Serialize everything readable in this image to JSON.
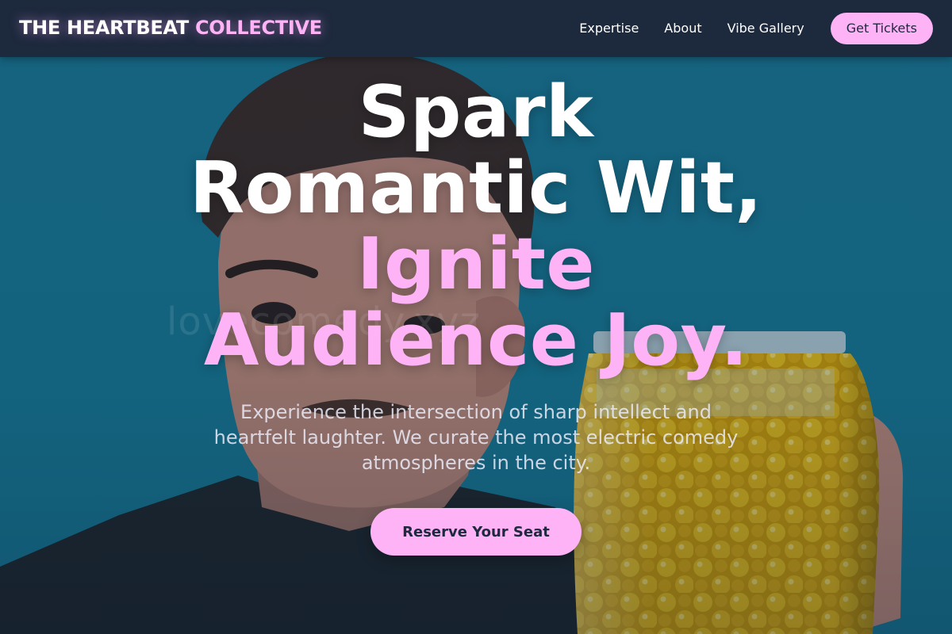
{
  "navbar": {
    "brand": {
      "primary": "THE HEARTBEAT",
      "accent": "COLLECTIVE"
    },
    "links": [
      {
        "label": "Expertise"
      },
      {
        "label": "About"
      },
      {
        "label": "Vibe Gallery"
      }
    ],
    "cta_label": "Get Tickets"
  },
  "hero": {
    "headline": {
      "white_lines": [
        "Spark",
        "Romantic Wit,"
      ],
      "pink_lines": [
        "Ignite",
        "Audience Joy."
      ]
    },
    "subtext": "Experience the intersection of sharp intellect and heartfelt laughter. We curate the most electric comedy atmospheres in the city.",
    "cta_label": "Reserve Your Seat",
    "watermark": "lovecomedy.xyz",
    "background_image": "man-holding-jar-of-yellow-candy"
  },
  "colors": {
    "accent": "#ffb3f7",
    "nav_bg": "#1d293d",
    "hero_bg": "#147a95",
    "text_light": "#ffffff"
  }
}
